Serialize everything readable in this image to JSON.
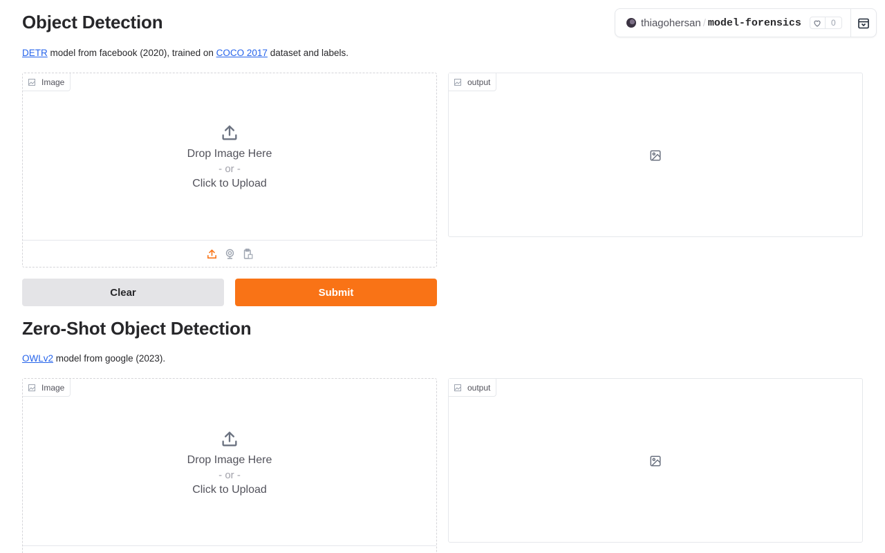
{
  "space_badge": {
    "owner": "thiagohersan",
    "space": "model-forensics",
    "likes": "0"
  },
  "sections": [
    {
      "title": "Object Detection",
      "desc_link1": "DETR",
      "desc_mid": " model from facebook (2020), trained on ",
      "desc_link2": "COCO 2017",
      "desc_end": " dataset and labels.",
      "input_label": "Image",
      "output_label": "output",
      "drop_line1": "Drop Image Here",
      "drop_line2": "- or -",
      "drop_line3": "Click to Upload",
      "clear_label": "Clear",
      "submit_label": "Submit"
    },
    {
      "title": "Zero-Shot Object Detection",
      "desc_link1": "OWLv2",
      "desc_mid": " model from google (2023).",
      "input_label": "Image",
      "output_label": "output",
      "drop_line1": "Drop Image Here",
      "drop_line2": "- or -",
      "drop_line3": "Click to Upload"
    }
  ],
  "colors": {
    "accent": "#f97316",
    "link": "#2563eb",
    "clear_bg": "#e4e4e7"
  },
  "icons": [
    "upload-icon",
    "webcam-icon",
    "clipboard-icon",
    "image-icon",
    "heart-icon",
    "collapse-icon"
  ]
}
